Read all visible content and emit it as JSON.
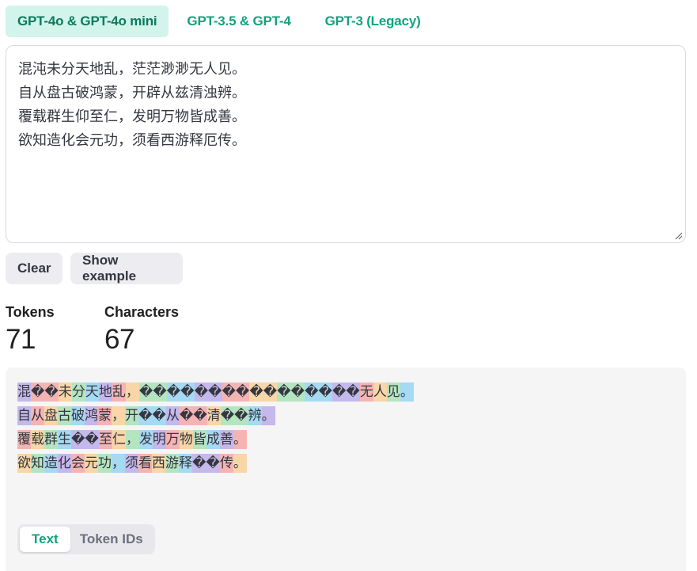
{
  "tabs": [
    {
      "label": "GPT-4o & GPT-4o mini",
      "active": true
    },
    {
      "label": "GPT-3.5 & GPT-4",
      "active": false
    },
    {
      "label": "GPT-3 (Legacy)",
      "active": false
    }
  ],
  "editor": {
    "lines": [
      "混沌未分天地乱，茫茫渺渺无人见。",
      "自从盘古破鸿蒙，开辟从兹清浊辨。",
      "覆载群生仰至仁，发明万物皆成善。",
      "欲知造化会元功，须看西游释厄传。"
    ]
  },
  "buttons": {
    "clear": "Clear",
    "show_example": "Show example"
  },
  "stats": {
    "tokens_label": "Tokens",
    "tokens_value": "71",
    "characters_label": "Characters",
    "characters_value": "67"
  },
  "token_colors": [
    "#c5b8ec",
    "#f5b4b4",
    "#f8d6a8",
    "#b5e5c0",
    "#a6d9f2"
  ],
  "output": {
    "lines": [
      [
        "混",
        "��",
        "未",
        "分",
        "天",
        "地",
        "乱",
        "，",
        "��",
        "��",
        "��",
        "��",
        "��",
        "��",
        "��",
        "��",
        "无",
        "人",
        "见",
        "。"
      ],
      [
        "自",
        "从",
        "盘",
        "古",
        "破",
        "鸿",
        "蒙",
        "，",
        "开",
        "��",
        "从",
        "��",
        "清",
        "��",
        "辨",
        "。"
      ],
      [
        "覆",
        "载",
        "群",
        "生",
        "��",
        "至",
        "仁",
        "，",
        "发",
        "明",
        "万",
        "物",
        "皆",
        "成",
        "善",
        "。"
      ],
      [
        "欲",
        "知",
        "造",
        "化",
        "会",
        "元",
        "功",
        "，",
        "须",
        "看",
        "西",
        "游",
        "释",
        "��",
        "传",
        "。"
      ]
    ]
  },
  "view_toggle": {
    "text_label": "Text",
    "ids_label": "Token IDs",
    "active": "text"
  }
}
